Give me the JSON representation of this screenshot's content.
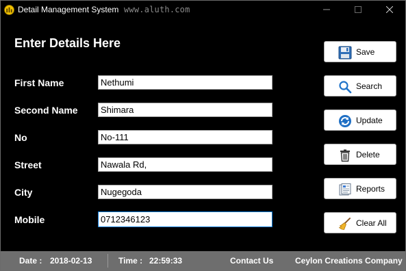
{
  "window": {
    "title": "Detail Management System",
    "watermark": "www.aluth.com"
  },
  "form": {
    "heading": "Enter Details Here",
    "fields": [
      {
        "label": "First Name",
        "value": "Nethumi"
      },
      {
        "label": "Second Name",
        "value": "Shimara"
      },
      {
        "label": "No",
        "value": "No-111"
      },
      {
        "label": "Street",
        "value": "Nawala Rd,"
      },
      {
        "label": "City",
        "value": "Nugegoda"
      },
      {
        "label": "Mobile",
        "value": "0712346123"
      }
    ]
  },
  "buttons": {
    "save": "Save",
    "search": "Search",
    "update": "Update",
    "delete": "Delete",
    "reports": "Reports",
    "clear_all": "Clear All"
  },
  "statusbar": {
    "date_label": "Date :",
    "date_value": "2018-02-13",
    "time_label": "Time :",
    "time_value": "22:59:33",
    "contact": "Contact Us",
    "company": "Ceylon Creations Company"
  },
  "colors": {
    "background": "#000000",
    "statusbar": "#6e6e6e",
    "focus_border": "#0078d7"
  },
  "icons": [
    "app-icon",
    "minimize-icon",
    "maximize-icon",
    "close-icon",
    "floppy-disk-icon",
    "magnifier-icon",
    "refresh-icon",
    "trash-icon",
    "report-icon",
    "broom-icon"
  ]
}
